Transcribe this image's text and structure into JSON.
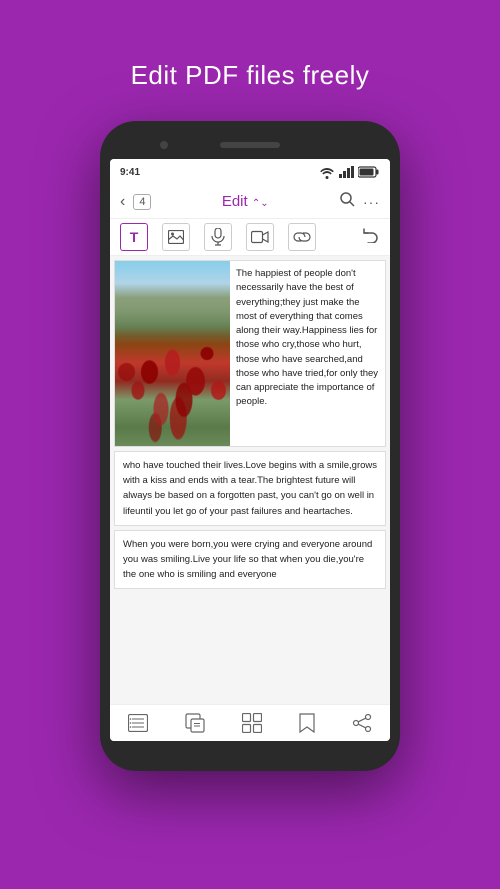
{
  "header": {
    "title": "Edit PDF files freely"
  },
  "status_bar": {
    "time": "9:41",
    "wifi": "WiFi",
    "signal": "Signal",
    "battery": "Battery"
  },
  "app_bar": {
    "back_label": "‹",
    "page_number": "4",
    "title": "Edit",
    "search_label": "Search",
    "more_label": "···"
  },
  "toolbar": {
    "text_btn": "T",
    "image_btn": "⊞",
    "mic_btn": "🎤",
    "video_btn": "🎬",
    "link_btn": "🔗",
    "undo_btn": "↩"
  },
  "pdf_content": {
    "main_text": "The happiest of people don't necessarily have the best of everything;they just make the most of everything that comes along their way.Happiness lies for those who cry,those who hurt, those who have searched,and those who have tried,for only they can appreciate the importance of people.",
    "second_paragraph": "who have touched their lives.Love begins with a smile,grows with a kiss and ends with a tear.The brightest future will always be based on a forgotten past, you can't go on well in lifeuntil you let go of your past failures and heartaches.",
    "third_paragraph": "When you were born,you were crying and everyone around you was smiling.Live your life so that when you die,you're the one who is smiling and everyone"
  },
  "bottom_nav": {
    "list_icon": "list",
    "edit_icon": "edit",
    "grid_icon": "grid",
    "bookmark_icon": "bookmark",
    "share_icon": "share"
  }
}
